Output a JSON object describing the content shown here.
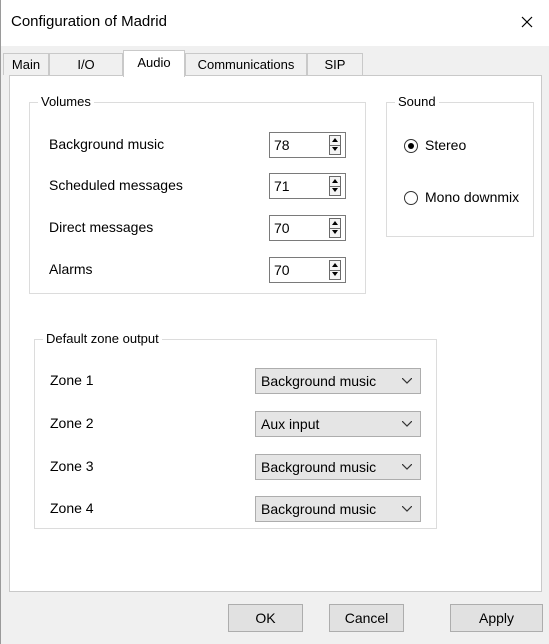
{
  "window": {
    "title": "Configuration of Madrid"
  },
  "tabs": [
    {
      "label": "Main"
    },
    {
      "label": "I/O"
    },
    {
      "label": "Audio",
      "active": true
    },
    {
      "label": "Communications"
    },
    {
      "label": "SIP"
    }
  ],
  "volumes": {
    "legend": "Volumes",
    "rows": [
      {
        "label": "Background music",
        "value": "78"
      },
      {
        "label": "Scheduled messages",
        "value": "71"
      },
      {
        "label": "Direct messages",
        "value": "70"
      },
      {
        "label": "Alarms",
        "value": "70"
      }
    ]
  },
  "sound": {
    "legend": "Sound",
    "options": [
      {
        "label": "Stereo",
        "selected": true
      },
      {
        "label": "Mono downmix",
        "selected": false
      }
    ]
  },
  "zones": {
    "legend": "Default zone output",
    "rows": [
      {
        "label": "Zone 1",
        "value": "Background music"
      },
      {
        "label": "Zone 2",
        "value": "Aux input"
      },
      {
        "label": "Zone 3",
        "value": "Background music"
      },
      {
        "label": "Zone 4",
        "value": "Background music"
      }
    ]
  },
  "buttons": {
    "ok": "OK",
    "cancel": "Cancel",
    "apply": "Apply"
  },
  "icons": {
    "close": "close-icon",
    "spin_up": "arrow-up-icon",
    "spin_down": "arrow-down-icon",
    "dropdown": "chevron-down-icon"
  }
}
